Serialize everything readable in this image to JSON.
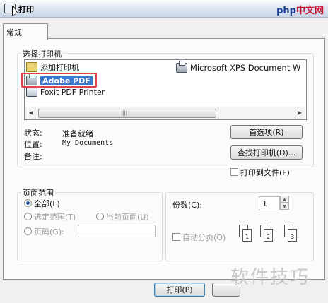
{
  "window": {
    "title": "打印"
  },
  "watermark": {
    "brand": "php",
    "site": "中文网",
    "bottom": "软件技巧"
  },
  "tabs": [
    {
      "label": "常规"
    }
  ],
  "printer_group": {
    "legend": "选择打印机",
    "printers": [
      {
        "label": "添加打印机",
        "icon": "add-printer-icon"
      },
      {
        "label": "Adobe PDF",
        "icon": "printer-icon",
        "selected": true
      },
      {
        "label": "Foxit PDF Printer",
        "icon": "printer-icon"
      },
      {
        "label": "Microsoft XPS Document W",
        "icon": "printer-icon"
      }
    ]
  },
  "status": {
    "state_label": "状态:",
    "state_value": "准备就绪",
    "location_label": "位置:",
    "location_value": "My Documents",
    "comment_label": "备注:"
  },
  "buttons": {
    "preferences": "首选项(R)",
    "find_printer": "查找打印机(D)...",
    "print": "打印(P)"
  },
  "print_to_file": "打印到文件(F)",
  "page_range": {
    "legend": "页面范围",
    "all": "全部(L)",
    "selection": "选定范围(T)",
    "current": "当前页面(U)",
    "pages": "页码(G):"
  },
  "copies": {
    "label": "份数(C):",
    "value": "1"
  },
  "collate": {
    "label": "自动分页(O)"
  }
}
